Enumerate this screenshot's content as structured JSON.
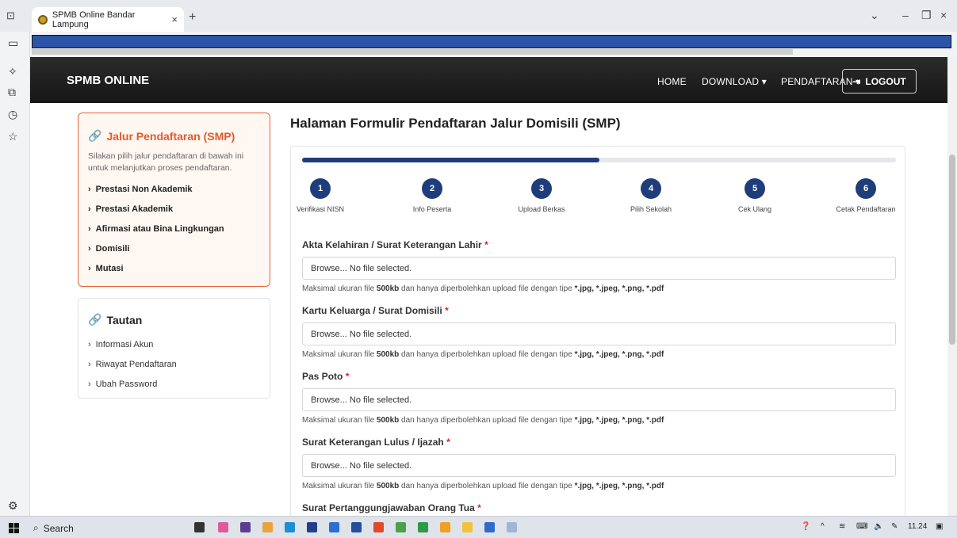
{
  "browser": {
    "tab_title": "SPMB Online Bandar Lampung",
    "tab_close": "×",
    "new_tab": "+",
    "minimize": "–",
    "restore": "❐",
    "close": "×",
    "chevron": "⌄"
  },
  "navbar": {
    "brand": "SPMB ONLINE",
    "home": "HOME",
    "download": "DOWNLOAD ▾",
    "pendaftaran": "PENDAFTARAN ▾",
    "logout": "LOGOUT"
  },
  "jalur": {
    "title": "Jalur Pendaftaran (SMP)",
    "description": "Silakan pilih jalur pendaftaran di bawah ini untuk melanjutkan proses pendaftaran.",
    "items": [
      "Prestasi Non Akademik",
      "Prestasi Akademik",
      "Afirmasi atau Bina Lingkungan",
      "Domisili",
      "Mutasi"
    ]
  },
  "tautan": {
    "title": "Tautan",
    "items": [
      "Informasi Akun",
      "Riwayat Pendaftaran",
      "Ubah Password"
    ]
  },
  "main": {
    "title": "Halaman Formulir Pendaftaran Jalur Domisili (SMP)",
    "progress_percent": 50,
    "steps": [
      {
        "number": "1",
        "label": "Verifikasi NISN"
      },
      {
        "number": "2",
        "label": "Info Peserta"
      },
      {
        "number": "3",
        "label": "Upload Berkas"
      },
      {
        "number": "4",
        "label": "Pilih Sekolah"
      },
      {
        "number": "5",
        "label": "Cek Ulang"
      },
      {
        "number": "6",
        "label": "Cetak Pendaftaran"
      }
    ],
    "fields": [
      {
        "label": "Akta Kelahiran / Surat Keterangan Lahir",
        "value": "Browse... No file selected."
      },
      {
        "label": "Kartu Keluarga / Surat Domisili",
        "value": "Browse... No file selected."
      },
      {
        "label": "Pas Poto",
        "value": "Browse... No file selected."
      },
      {
        "label": "Surat Keterangan Lulus / Ijazah",
        "value": "Browse... No file selected."
      },
      {
        "label": "Surat Pertanggungjawaban Orang Tua",
        "value": ""
      }
    ],
    "help_prefix": "Maksimal ukuran file ",
    "help_size": "500kb",
    "help_middle": " dan hanya diperbolehkan upload file dengan tipe ",
    "help_types": "*.jpg, *.jpeg, *.png, *.pdf",
    "required_mark": "*"
  },
  "taskbar": {
    "search": "Search",
    "time": "11.24"
  },
  "colors": {
    "accent_orange": "#e35a2b",
    "primary_navy": "#1f3d7a"
  }
}
